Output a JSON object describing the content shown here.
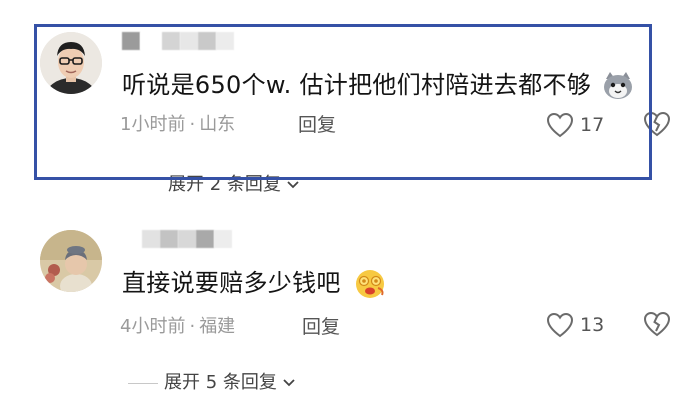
{
  "comments": [
    {
      "text": "听说是650个w. 估计把他们村陪进去都不够",
      "time": "1小时前",
      "location": "山东",
      "reply_label": "回复",
      "like_count": "17",
      "expand_label": "展开 2 条回复",
      "highlighted": true,
      "highlight_color": "#3551a6"
    },
    {
      "text": "直接说要赔多少钱吧",
      "time": "4小时前",
      "location": "福建",
      "reply_label": "回复",
      "like_count": "13",
      "expand_label": "展开 5 条回复",
      "highlighted": false
    }
  ],
  "icons": {
    "like": "heart-outline-icon",
    "dislike": "broken-heart-icon",
    "expand": "chevron-down-icon"
  },
  "colors": {
    "meta_text": "#9a9a9a",
    "body_text": "#141414",
    "highlight_border": "#3551a6"
  }
}
